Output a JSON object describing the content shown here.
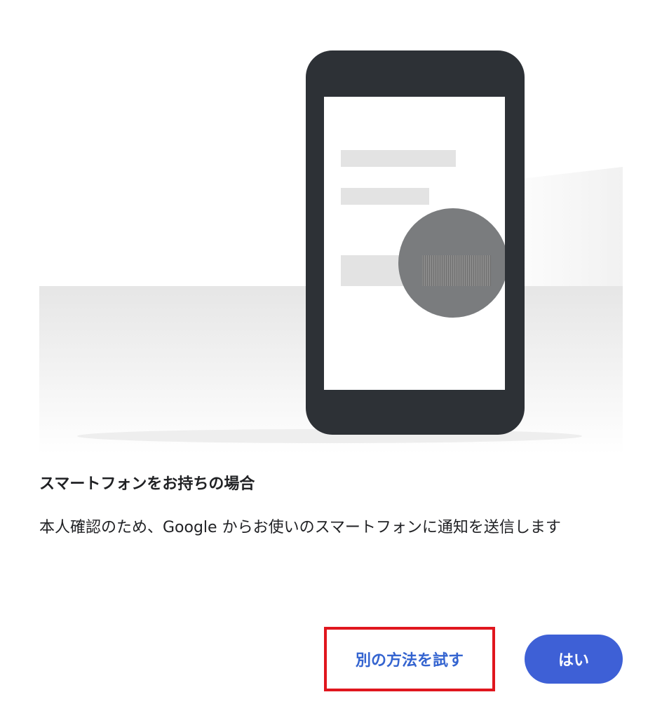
{
  "prompt": {
    "heading": "スマートフォンをお持ちの場合",
    "description": "本人確認のため、Google からお使いのスマートフォンに通知を送信します"
  },
  "actions": {
    "try_another_label": "別の方法を試す",
    "yes_label": "はい"
  },
  "colors": {
    "accent": "#3e60d6",
    "link": "#3464d0",
    "highlight_border": "#e0161e",
    "phone_body": "#2d3136",
    "overlay_circle": "#7a7c7e"
  },
  "icons": {
    "illustration": "smartphone-notification-illustration"
  }
}
